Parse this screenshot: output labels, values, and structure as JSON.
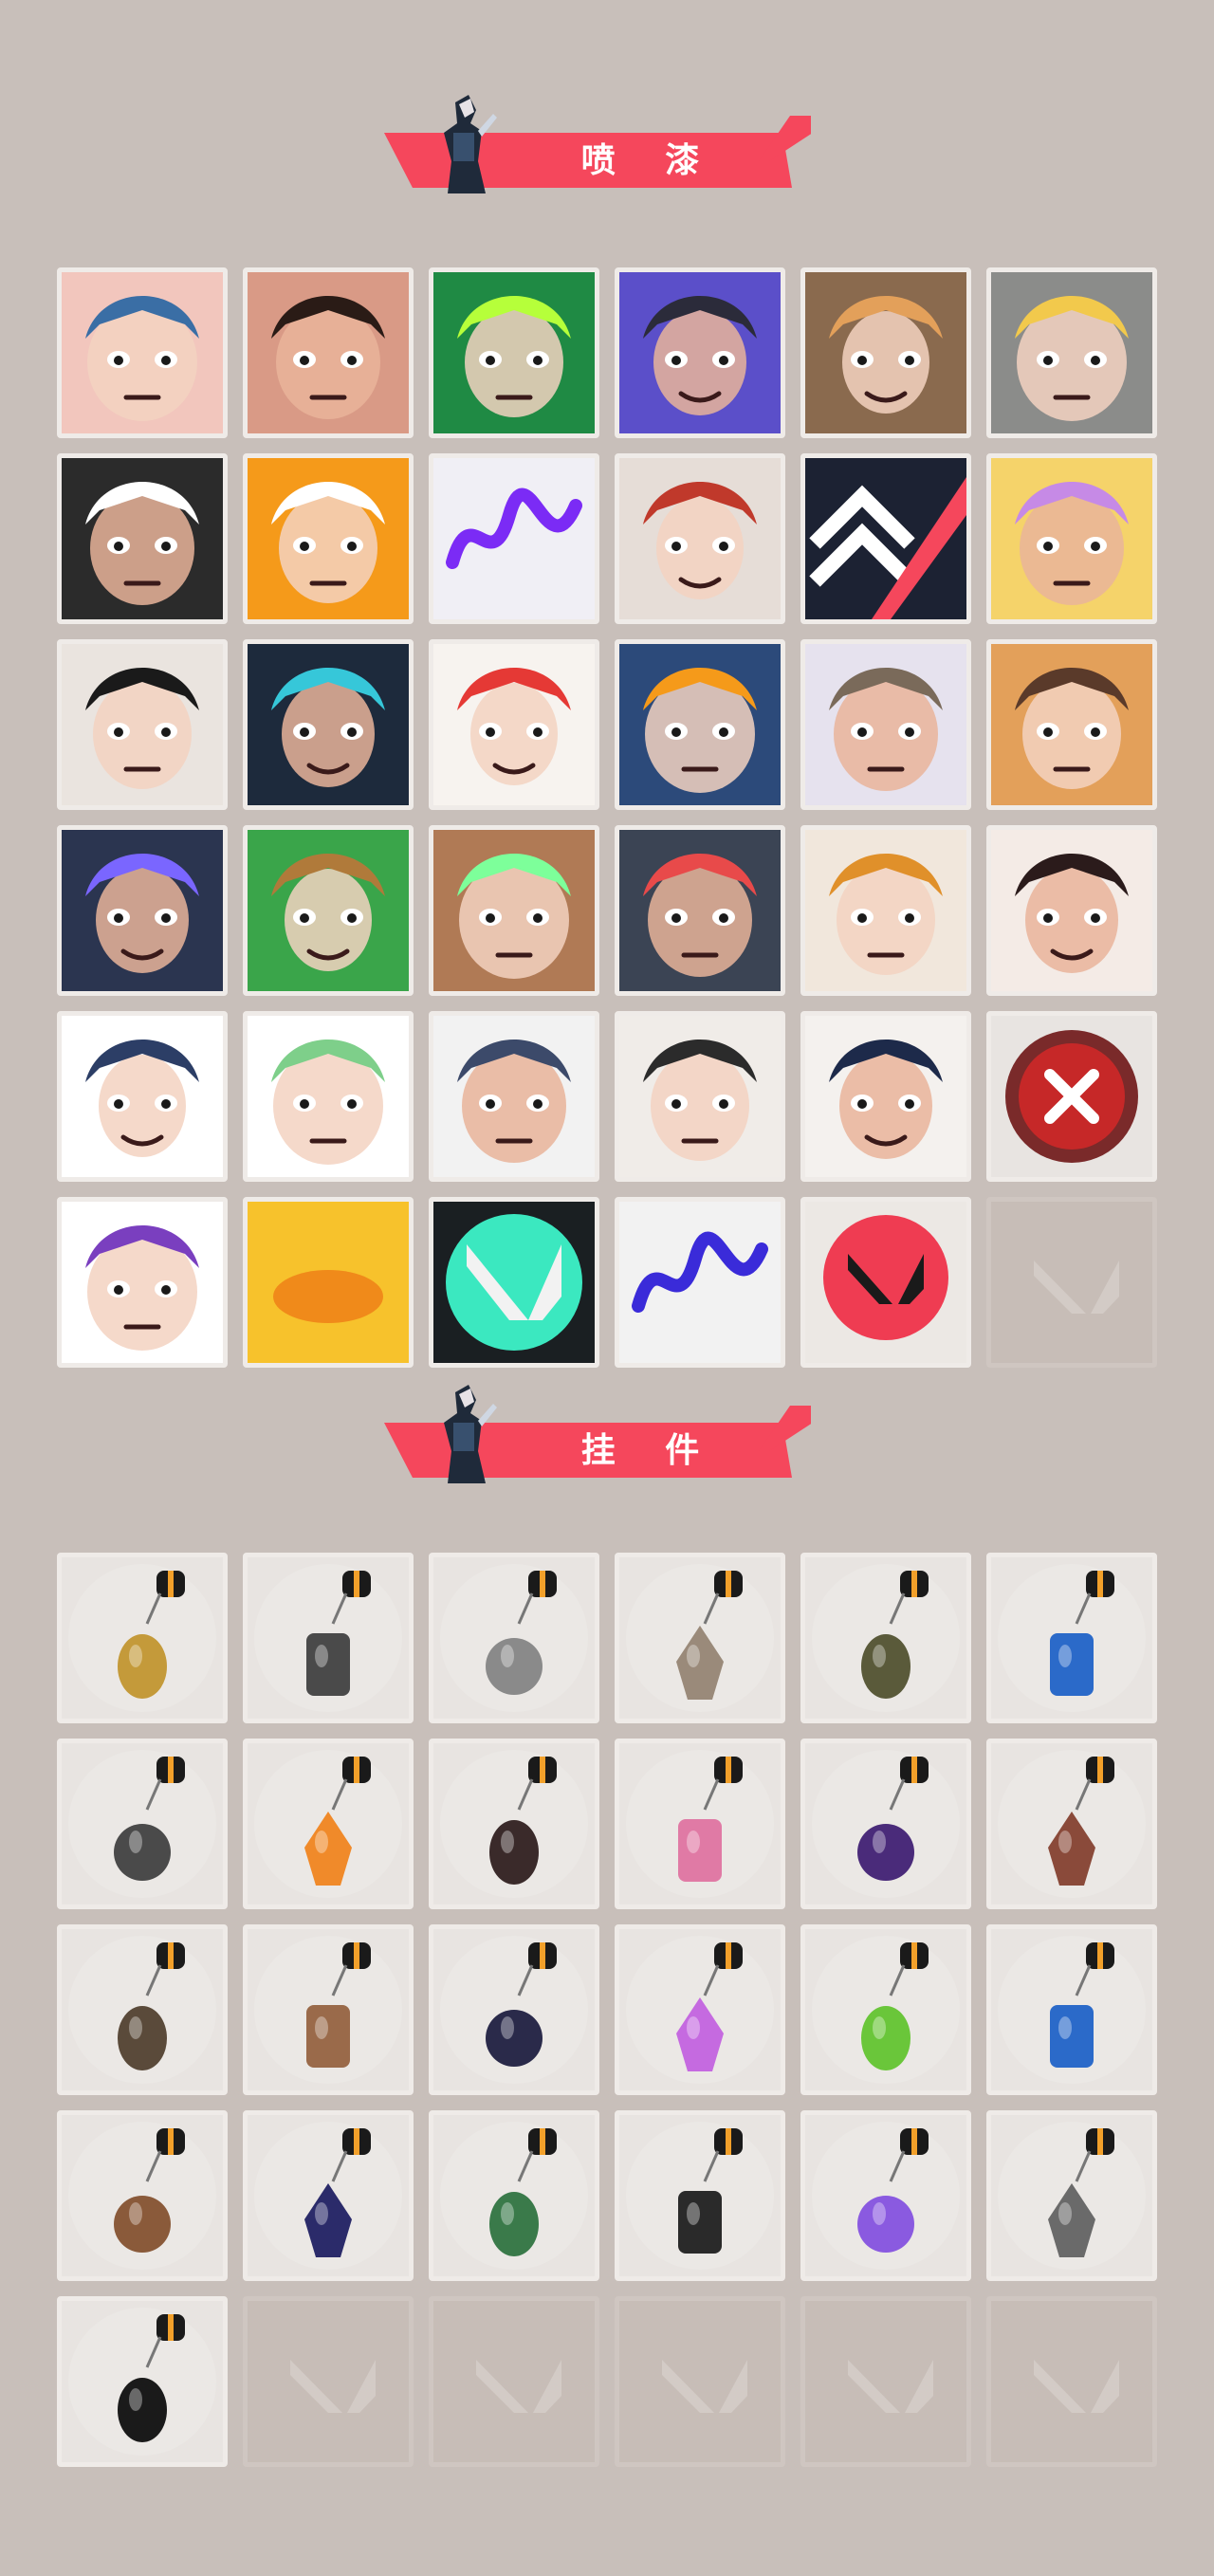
{
  "sections": [
    {
      "title": "喷 漆"
    },
    {
      "title": "挂 件"
    }
  ],
  "sprays": [
    {
      "icon": "face-butterfly-icon",
      "bg": "#f2c6bd",
      "accent": "#3a6ea5"
    },
    {
      "icon": "angry-face-icon",
      "bg": "#d99a86",
      "accent": "#2a1b16"
    },
    {
      "icon": "green-mask-icon",
      "bg": "#1f8a44",
      "accent": "#b6ff3a"
    },
    {
      "icon": "robot-arm-icon",
      "bg": "#5b4fc9",
      "accent": "#2b2b3a"
    },
    {
      "icon": "penguin-beanie-icon",
      "bg": "#8a6a4e",
      "accent": "#e3a05a"
    },
    {
      "icon": "camera-robot-icon",
      "bg": "#8b8c8a",
      "accent": "#f2c94c"
    },
    {
      "icon": "sparkle-badge-icon",
      "bg": "#2b2b2b",
      "accent": "#ffffff"
    },
    {
      "icon": "orange-mask-icon",
      "bg": "#f59a1a",
      "accent": "#ffffff"
    },
    {
      "icon": "purple-scribble-icon",
      "bg": "#f0eff5",
      "accent": "#7b2bf5"
    },
    {
      "icon": "goggles-cat-icon",
      "bg": "#e6ddd7",
      "accent": "#c0392b"
    },
    {
      "icon": "chevron-logo-icon",
      "bg": "#1c2233",
      "accent": "#f5475c"
    },
    {
      "icon": "duck-hat-icon",
      "bg": "#f5d36a",
      "accent": "#c68ae6"
    },
    {
      "icon": "pixel-warrior-icon",
      "bg": "#eae4df",
      "accent": "#1a1a1a"
    },
    {
      "icon": "armored-helmet-icon",
      "bg": "#1d2a3c",
      "accent": "#36c7d9"
    },
    {
      "icon": "clown-face-icon",
      "bg": "#f7f3ef",
      "accent": "#e53935"
    },
    {
      "icon": "orange-hat-icon",
      "bg": "#2c4a7a",
      "accent": "#f59a1a"
    },
    {
      "icon": "raccoon-icon",
      "bg": "#e6e2ee",
      "accent": "#7a6a5a"
    },
    {
      "icon": "bearded-face-icon",
      "bg": "#e3a05a",
      "accent": "#5a3a2a"
    },
    {
      "icon": "anime-boy-icon",
      "bg": "#2b3550",
      "accent": "#7a66ff"
    },
    {
      "icon": "green-crate-icon",
      "bg": "#3aa54a",
      "accent": "#b07a3a"
    },
    {
      "icon": "green-eyes-icon",
      "bg": "#b07a55",
      "accent": "#7dff9a"
    },
    {
      "icon": "crying-mole-icon",
      "bg": "#3b4454",
      "accent": "#e84a4a"
    },
    {
      "icon": "tiger-icon",
      "bg": "#f1e7dc",
      "accent": "#e0902a"
    },
    {
      "icon": "girl-pencil-icon",
      "bg": "#f4ebe6",
      "accent": "#2b1b1b"
    },
    {
      "icon": "penguin-helmet-icon",
      "bg": "#ffffff",
      "accent": "#2c3e66"
    },
    {
      "icon": "frog-hat-icon",
      "bg": "#ffffff",
      "accent": "#7ecf8a"
    },
    {
      "icon": "pixel-sloth-gun-icon",
      "bg": "#f2f2f2",
      "accent": "#3c4a6a"
    },
    {
      "icon": "two-agents-icon",
      "bg": "#f0ece8",
      "accent": "#2b2b2b"
    },
    {
      "icon": "silhouette-icon",
      "bg": "#f4f1ee",
      "accent": "#1d2a4a"
    },
    {
      "icon": "close-x-icon",
      "bg": "#e8e4e1",
      "accent": "#c62828"
    },
    {
      "icon": "agent-girl-icon",
      "bg": "#ffffff",
      "accent": "#7a3fbf"
    },
    {
      "icon": "duck-bill-icon",
      "bg": "#f7c22c",
      "accent": "#f08a1a"
    },
    {
      "icon": "valorant-green-splash-icon",
      "bg": "#1a1f22",
      "accent": "#3be8c0"
    },
    {
      "icon": "graffiti-tag-icon",
      "bg": "#f2f2f2",
      "accent": "#3a2bd9"
    },
    {
      "icon": "valorant-red-drip-icon",
      "bg": "#ece8e4",
      "accent": "#ef3c52"
    },
    {
      "icon": "valorant-logo-icon",
      "bg": "#c7bdb7",
      "accent": "#d3cbc6",
      "empty": true
    }
  ],
  "charms": [
    {
      "icon": "gold-creature-charm-icon",
      "accent": "#c49a3a"
    },
    {
      "icon": "robot-drone-charm-icon",
      "accent": "#4a4a4a"
    },
    {
      "icon": "grill-charm-icon",
      "accent": "#8a8a8a"
    },
    {
      "icon": "raccoon-charm-icon",
      "accent": "#9a8a7a"
    },
    {
      "icon": "pouch-charm-icon",
      "accent": "#5a5a3a"
    },
    {
      "icon": "blue-bottle-charm-icon",
      "accent": "#2b6ac9"
    },
    {
      "icon": "spike-blade-charm-icon",
      "accent": "#4a4a4a"
    },
    {
      "icon": "chicken-charm-icon",
      "accent": "#f08a2a"
    },
    {
      "icon": "braided-rope-charm-icon",
      "accent": "#3a2a2a"
    },
    {
      "icon": "cupcake-charm-icon",
      "accent": "#e07aa5"
    },
    {
      "icon": "ep9-badge-charm-icon",
      "accent": "#4a2b7a"
    },
    {
      "icon": "teddy-bear-charm-icon",
      "accent": "#8a4a3a"
    },
    {
      "icon": "gun-charm-icon",
      "accent": "#5a4a3a"
    },
    {
      "icon": "crate-charm-icon",
      "accent": "#9a6a4a"
    },
    {
      "icon": "tassel-charm-icon",
      "accent": "#2a2a4a"
    },
    {
      "icon": "lava-lamp-charm-icon",
      "accent": "#c56ae0"
    },
    {
      "icon": "green-device-charm-icon",
      "accent": "#6ac63a"
    },
    {
      "icon": "astronaut-charm-icon",
      "accent": "#2b6ac9"
    },
    {
      "icon": "radio-charm-icon",
      "accent": "#8a5a3a"
    },
    {
      "icon": "ep9-coin-charm-icon",
      "accent": "#2b2b6a"
    },
    {
      "icon": "spray-can-charm-icon",
      "accent": "#3a7a4a"
    },
    {
      "icon": "card-charm-icon",
      "accent": "#2a2a2a"
    },
    {
      "icon": "ufo-charm-icon",
      "accent": "#8a5ae0"
    },
    {
      "icon": "cat-bag-charm-icon",
      "accent": "#6a6a6a"
    },
    {
      "icon": "valorant-coin-charm-icon",
      "accent": "#1a1a1a"
    },
    {
      "icon": "valorant-logo-icon",
      "empty": true
    },
    {
      "icon": "valorant-logo-icon",
      "empty": true
    },
    {
      "icon": "valorant-logo-icon",
      "empty": true
    },
    {
      "icon": "valorant-logo-icon",
      "empty": true
    },
    {
      "icon": "valorant-logo-icon",
      "empty": true
    }
  ]
}
